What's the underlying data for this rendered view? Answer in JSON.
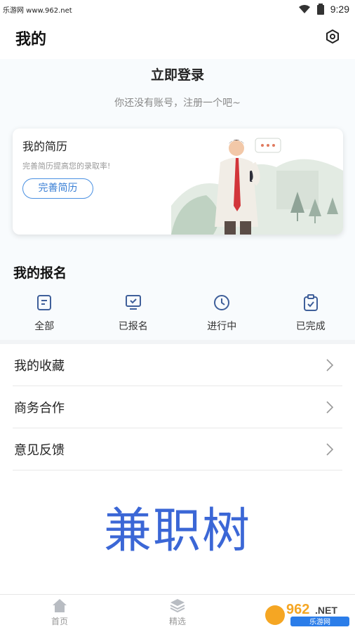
{
  "status_bar": {
    "watermark": "乐游网 www.962.net",
    "time": "9:29",
    "icons": [
      "wifi-icon",
      "battery-icon"
    ]
  },
  "header": {
    "title": "我的",
    "settings_icon": "settings-icon"
  },
  "login": {
    "title": "立即登录",
    "subtitle": "你还没有账号，注册一个吧~"
  },
  "resume_card": {
    "title": "我的简历",
    "subtitle": "完善简历提高您的录取率!",
    "button_label": "完善简历"
  },
  "signup_section": {
    "title": "我的报名",
    "items": [
      {
        "label": "全部",
        "icon": "list-icon"
      },
      {
        "label": "已报名",
        "icon": "monitor-check-icon"
      },
      {
        "label": "进行中",
        "icon": "clock-icon"
      },
      {
        "label": "已完成",
        "icon": "clipboard-check-icon"
      }
    ]
  },
  "menu": {
    "items": [
      {
        "label": "我的收藏"
      },
      {
        "label": "商务合作"
      },
      {
        "label": "意见反馈"
      }
    ]
  },
  "brand": {
    "text": "兼职树"
  },
  "tab_bar": {
    "items": [
      {
        "label": "首页",
        "icon": "home-icon"
      },
      {
        "label": "精选",
        "icon": "layers-icon"
      }
    ]
  },
  "watermark_logo": {
    "text": "962.NET 乐游网"
  },
  "colors": {
    "accent": "#3b67d6",
    "button_border": "#4a90e2",
    "page_bg": "#f8fbfd"
  }
}
